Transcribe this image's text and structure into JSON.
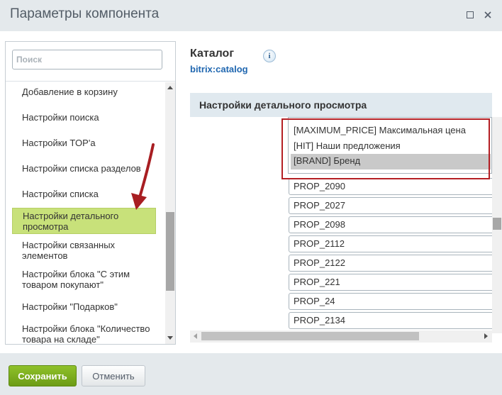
{
  "window": {
    "title": "Параметры компонента"
  },
  "search": {
    "placeholder": "Поиск"
  },
  "sidebar": {
    "items": [
      {
        "label": "Добавление в корзину"
      },
      {
        "label": "Настройки поиска"
      },
      {
        "label": "Настройки TOP'а"
      },
      {
        "label": "Настройки списка разделов"
      },
      {
        "label": "Настройки списка"
      },
      {
        "label": "Настройки детального просмотра",
        "active": true
      },
      {
        "label": "Настройки связанных элементов"
      },
      {
        "label": "Настройки блока \"С этим товаром покупают\""
      },
      {
        "label": "Настройки \"Подарков\""
      },
      {
        "label": "Настройки блока \"Количество товара на складе\""
      }
    ]
  },
  "component": {
    "title": "Каталог",
    "code": "bitrix:catalog",
    "info_glyph": "i"
  },
  "section": {
    "title": "Настройки детального просмотра"
  },
  "properties_select": {
    "options": [
      {
        "label": "[MAXIMUM_PRICE] Максимальная цена",
        "selected": false
      },
      {
        "label": "[HIT] Наши предложения",
        "selected": false
      },
      {
        "label": "[BRAND] Бренд",
        "selected": true
      }
    ]
  },
  "prop_fields": [
    "PROP_2090",
    "PROP_2027",
    "PROP_2098",
    "PROP_2112",
    "PROP_2122",
    "PROP_221",
    "PROP_24",
    "PROP_2134"
  ],
  "buttons": {
    "save": "Сохранить",
    "cancel": "Отменить"
  },
  "colors": {
    "active_item": "#c8e17a",
    "highlight_frame": "#b41f24",
    "save_button": "#7bac1e",
    "link": "#2067b0"
  }
}
